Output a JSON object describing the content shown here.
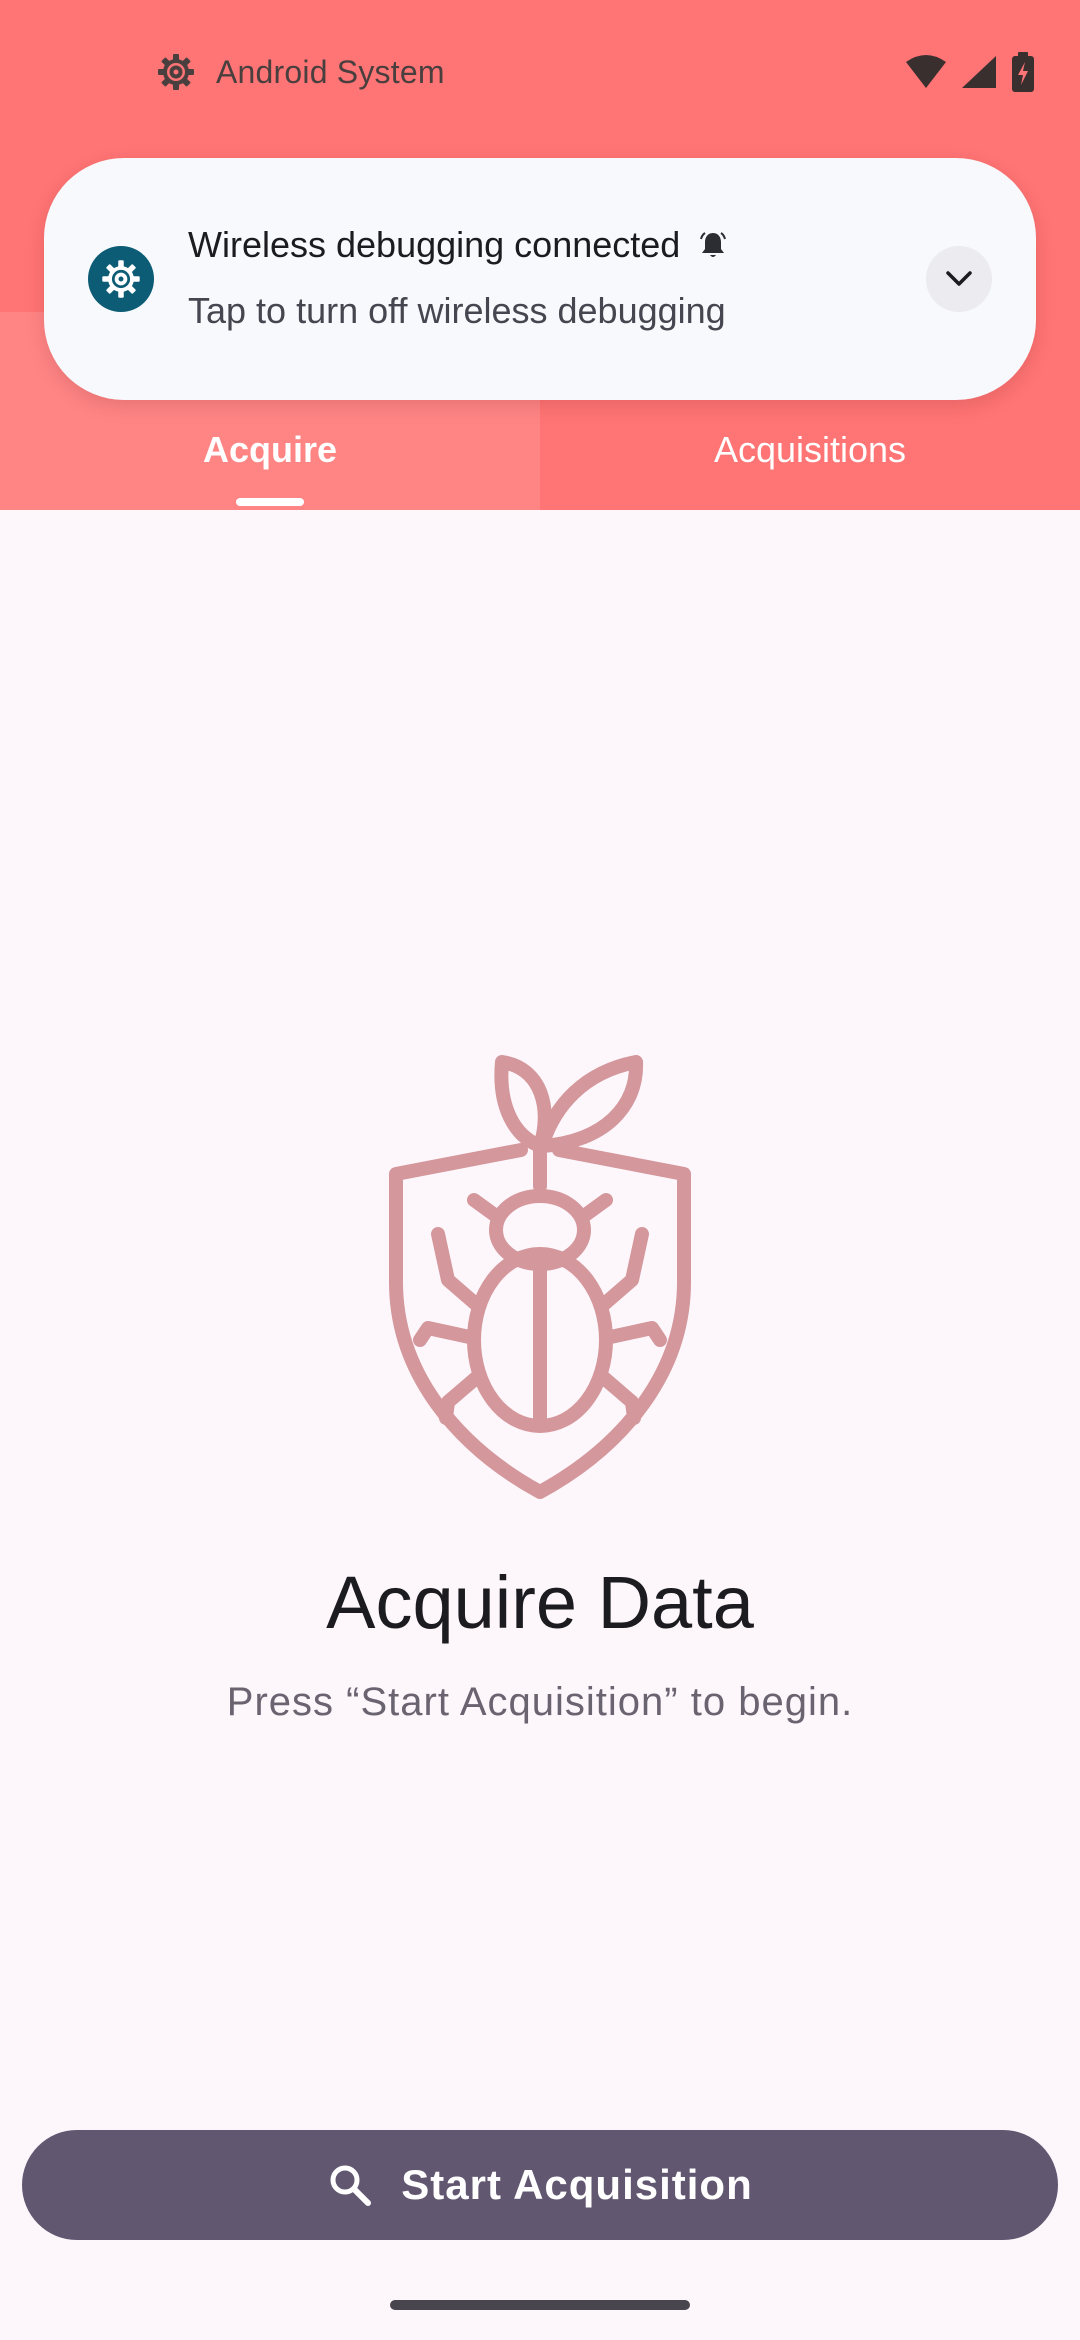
{
  "status_bar": {
    "app_icon": "settings-gear-icon",
    "app_label": "Android System",
    "icons": [
      "wifi-icon",
      "cellular-signal-icon",
      "battery-charging-icon"
    ]
  },
  "notification": {
    "app_icon": "settings-gear-icon",
    "title": "Wireless debugging connected",
    "alert_icon": "notification-bell-icon",
    "text": "Tap to turn off wireless debugging",
    "expand_icon": "chevron-down-icon"
  },
  "tabs": [
    {
      "label": "Acquire",
      "selected": true
    },
    {
      "label": "Acquisitions",
      "selected": false
    }
  ],
  "main": {
    "icon": "bug-shield-icon",
    "title": "Acquire Data",
    "subtitle": "Press “Start Acquisition” to begin."
  },
  "actions": {
    "start_icon": "search-icon",
    "start_label": "Start Acquisition"
  },
  "colors": {
    "header": "#ff7474",
    "selected_tab": "#ff8585",
    "background": "#fdf7fc",
    "icon": "#d4979c",
    "button": "#625770",
    "notification_icon": "#0b5c74"
  }
}
